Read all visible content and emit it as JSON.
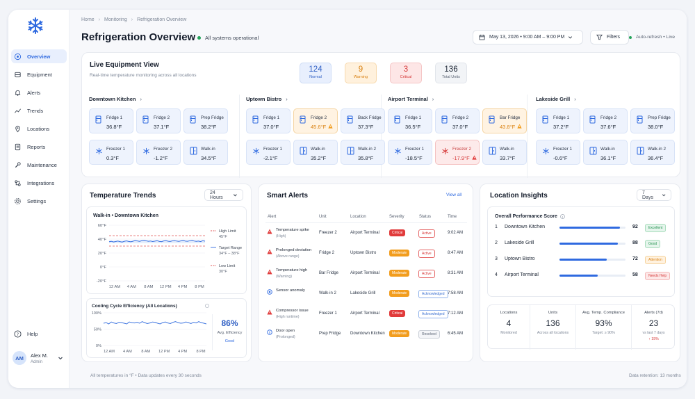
{
  "sidebar": {
    "items": [
      {
        "label": "Overview",
        "icon": "overview-icon",
        "active": true
      },
      {
        "label": "Equipment",
        "icon": "equipment-icon"
      },
      {
        "label": "Alerts",
        "icon": "bell-icon"
      },
      {
        "label": "Trends",
        "icon": "trend-icon"
      },
      {
        "label": "Locations",
        "icon": "pin-icon"
      },
      {
        "label": "Reports",
        "icon": "report-icon"
      },
      {
        "label": "Maintenance",
        "icon": "wrench-icon"
      },
      {
        "label": "Integrations",
        "icon": "integrations-icon"
      },
      {
        "label": "Settings",
        "icon": "gear-icon"
      }
    ],
    "help": "Help",
    "user": {
      "initials": "AM",
      "name": "Alex M.",
      "role": "Admin"
    }
  },
  "header": {
    "breadcrumb": [
      "Home",
      "Monitoring",
      "Refrigeration Overview"
    ],
    "title": "Refrigeration Overview",
    "status": "All systems operational",
    "date_range": "May 13, 2026 • 9:00 AM – 9:00 PM",
    "filters": "Filters",
    "auto_refresh": "Auto-refresh • Live"
  },
  "live": {
    "title": "Live Equipment View",
    "subtitle": "Real-time temperature monitoring across all locations",
    "stats": [
      {
        "value": "124",
        "label": "Normal"
      },
      {
        "value": "9",
        "label": "Warning"
      },
      {
        "value": "3",
        "label": "Critical"
      },
      {
        "value": "136",
        "label": "Total Units"
      }
    ],
    "locations": [
      {
        "name": "Downtown Kitchen",
        "units": [
          {
            "name": "Fridge 1",
            "temp": "36.8°F",
            "type": "fridge",
            "state": "normal"
          },
          {
            "name": "Fridge 2",
            "temp": "37.1°F",
            "type": "fridge",
            "state": "normal"
          },
          {
            "name": "Prep Fridge",
            "temp": "38.2°F",
            "type": "fridge",
            "state": "normal"
          },
          {
            "name": "Freezer 1",
            "temp": "0.3°F",
            "type": "freezer",
            "state": "normal"
          },
          {
            "name": "Freezer 2",
            "temp": "-1.2°F",
            "type": "freezer",
            "state": "normal"
          },
          {
            "name": "Walk-in",
            "temp": "34.5°F",
            "type": "walkin",
            "state": "normal"
          }
        ]
      },
      {
        "name": "Uptown Bistro",
        "units": [
          {
            "name": "Fridge 1",
            "temp": "37.0°F",
            "type": "fridge",
            "state": "normal"
          },
          {
            "name": "Fridge 2",
            "temp": "45.6°F",
            "type": "fridge",
            "state": "warning"
          },
          {
            "name": "Back Fridge",
            "temp": "37.3°F",
            "type": "fridge",
            "state": "normal"
          },
          {
            "name": "Freezer 1",
            "temp": "-2.1°F",
            "type": "freezer",
            "state": "normal"
          },
          {
            "name": "Walk-in",
            "temp": "35.2°F",
            "type": "walkin",
            "state": "normal"
          },
          {
            "name": "Walk-in 2",
            "temp": "35.8°F",
            "type": "walkin",
            "state": "normal"
          }
        ]
      },
      {
        "name": "Airport Terminal",
        "units": [
          {
            "name": "Fridge 1",
            "temp": "36.5°F",
            "type": "fridge",
            "state": "normal"
          },
          {
            "name": "Fridge 2",
            "temp": "37.0°F",
            "type": "fridge",
            "state": "normal"
          },
          {
            "name": "Bar Fridge",
            "temp": "43.8°F",
            "type": "fridge",
            "state": "warning"
          },
          {
            "name": "Freezer 1",
            "temp": "-18.5°F",
            "type": "freezer",
            "state": "normal"
          },
          {
            "name": "Freezer 2",
            "temp": "-17.9°F",
            "type": "freezer",
            "state": "critical"
          },
          {
            "name": "Walk-in",
            "temp": "33.7°F",
            "type": "walkin",
            "state": "normal"
          }
        ]
      },
      {
        "name": "Lakeside Grill",
        "units": [
          {
            "name": "Fridge 1",
            "temp": "37.2°F",
            "type": "fridge",
            "state": "normal"
          },
          {
            "name": "Fridge 2",
            "temp": "37.6°F",
            "type": "fridge",
            "state": "normal"
          },
          {
            "name": "Prep Fridge",
            "temp": "38.0°F",
            "type": "fridge",
            "state": "normal"
          },
          {
            "name": "Freezer 1",
            "temp": "-0.6°F",
            "type": "freezer",
            "state": "normal"
          },
          {
            "name": "Walk-in",
            "temp": "36.1°F",
            "type": "walkin",
            "state": "normal"
          },
          {
            "name": "Walk-in 2",
            "temp": "36.4°F",
            "type": "walkin",
            "state": "normal"
          }
        ]
      }
    ]
  },
  "trends": {
    "title": "Temperature Trends",
    "range": "24 Hours",
    "chart_data": [
      {
        "type": "line",
        "title": "Walk-in • Downtown Kitchen",
        "x": [
          "12 AM",
          "4 AM",
          "8 AM",
          "12 PM",
          "4 PM",
          "8 PM"
        ],
        "yticks": [
          "60°F",
          "40°F",
          "20°F",
          "0°F",
          "-20°F"
        ],
        "ylim": [
          -20,
          60
        ],
        "high_limit": 45,
        "low_limit": 30,
        "target_range": [
          34,
          38
        ],
        "series": [
          {
            "values": [
              36.2,
              36.8,
              35.9,
              36.5,
              37.2,
              36.4,
              35.8,
              36.9,
              37.5,
              36.6,
              36.1,
              37.0,
              38.2,
              37.4,
              36.8,
              37.9,
              38.4,
              37.6,
              36.9,
              37.3,
              36.5,
              37.1,
              37.8,
              36.8,
              36.3,
              37.4,
              38.1,
              37.0,
              36.6,
              37.5,
              38.0,
              37.2,
              36.7,
              37.6,
              38.3,
              37.1,
              36.9,
              37.7,
              38.5,
              37.3,
              36.8,
              37.2,
              36.4,
              37.9,
              37.0
            ]
          }
        ],
        "legend": [
          {
            "label": "High Limit",
            "value": "45°F"
          },
          {
            "label": "Target Range",
            "value": "34°F – 38°F"
          },
          {
            "label": "Low Limit",
            "value": "30°F"
          }
        ]
      },
      {
        "type": "line",
        "title": "Cooling Cycle Efficiency (All Locations)",
        "x": [
          "12 AM",
          "4 AM",
          "8 AM",
          "12 PM",
          "4 PM",
          "8 PM"
        ],
        "yticks": [
          "100%",
          "50%",
          "0%"
        ],
        "ylim": [
          0,
          100
        ],
        "series": [
          {
            "values": [
              68,
              70,
              66,
              72,
              69,
              67,
              71,
              70,
              68,
              66,
              72,
              70,
              69,
              71,
              68,
              73,
              70,
              67,
              69,
              72,
              71,
              68,
              66,
              70,
              72,
              69,
              67,
              71,
              73,
              70,
              68,
              69,
              72,
              70,
              67,
              71,
              69,
              73,
              70,
              68,
              66
            ]
          }
        ]
      }
    ],
    "efficiency": {
      "value": "86%",
      "label": "Avg. Efficiency",
      "status": "Good"
    }
  },
  "alerts": {
    "title": "Smart Alerts",
    "view_all": "View all",
    "columns": [
      "Alert",
      "Unit",
      "Location",
      "Severity",
      "Status",
      "Time"
    ],
    "rows": [
      {
        "icon": "warning-icon",
        "title": "Temperature spike",
        "detail": "(High)",
        "unit": "Freezer 2",
        "location": "Airport Terminal",
        "severity": "Critical",
        "status": "Active",
        "time": "9:02 AM"
      },
      {
        "icon": "warning-icon",
        "title": "Prolonged deviation",
        "detail": "(Above range)",
        "unit": "Fridge 2",
        "location": "Uptown Bistro",
        "severity": "Moderate",
        "status": "Active",
        "time": "8:47 AM"
      },
      {
        "icon": "warning-icon",
        "title": "Temperature high",
        "detail": "(Warning)",
        "unit": "Bar Fridge",
        "location": "Airport Terminal",
        "severity": "Moderate",
        "status": "Active",
        "time": "8:31 AM"
      },
      {
        "icon": "sensor-icon",
        "title": "Sensor anomaly",
        "detail": "",
        "unit": "Walk-in 2",
        "location": "Lakeside Grill",
        "severity": "Moderate",
        "status": "Acknowledged",
        "time": "7:58 AM"
      },
      {
        "icon": "warning-icon",
        "title": "Compressor issue",
        "detail": "(High runtime)",
        "unit": "Freezer 1",
        "location": "Airport Terminal",
        "severity": "Critical",
        "status": "Acknowledged",
        "time": "7:12 AM"
      },
      {
        "icon": "info-icon",
        "title": "Door open",
        "detail": "(Prolonged)",
        "unit": "Prep Fridge",
        "location": "Downtown Kitchen",
        "severity": "Moderate",
        "status": "Resolved",
        "time": "6:45 AM"
      }
    ]
  },
  "insights": {
    "title": "Location Insights",
    "range": "7 Days",
    "perf_title": "Overall Performance Score",
    "perf": [
      {
        "rank": "1",
        "name": "Downtown Kitchen",
        "score": 92,
        "label": "Excellent"
      },
      {
        "rank": "2",
        "name": "Lakeside Grill",
        "score": 88,
        "label": "Good"
      },
      {
        "rank": "3",
        "name": "Uptown Bistro",
        "score": 72,
        "label": "Attention"
      },
      {
        "rank": "4",
        "name": "Airport Terminal",
        "score": 58,
        "label": "Needs Help"
      }
    ],
    "summary": [
      {
        "label": "Locations",
        "value": "4",
        "sub": "Monitored"
      },
      {
        "label": "Units",
        "value": "136",
        "sub": "Across all locations"
      },
      {
        "label": "Avg. Temp. Compliance",
        "value": "93%",
        "sub": "Target: ≥ 90%"
      },
      {
        "label": "Alerts (7d)",
        "value": "23",
        "sub": "vs last 7 days",
        "delta": "↑ 15%"
      }
    ]
  },
  "footer": {
    "left": "All temperatures in °F  •  Data updates every 30 seconds",
    "right": "Data retention: 13 months"
  },
  "colors": {
    "accent": "#2f6ae0",
    "normal": "#2f6ae0",
    "warning": "#f29d1e",
    "critical": "#e13b3b",
    "good": "#25a35a"
  }
}
